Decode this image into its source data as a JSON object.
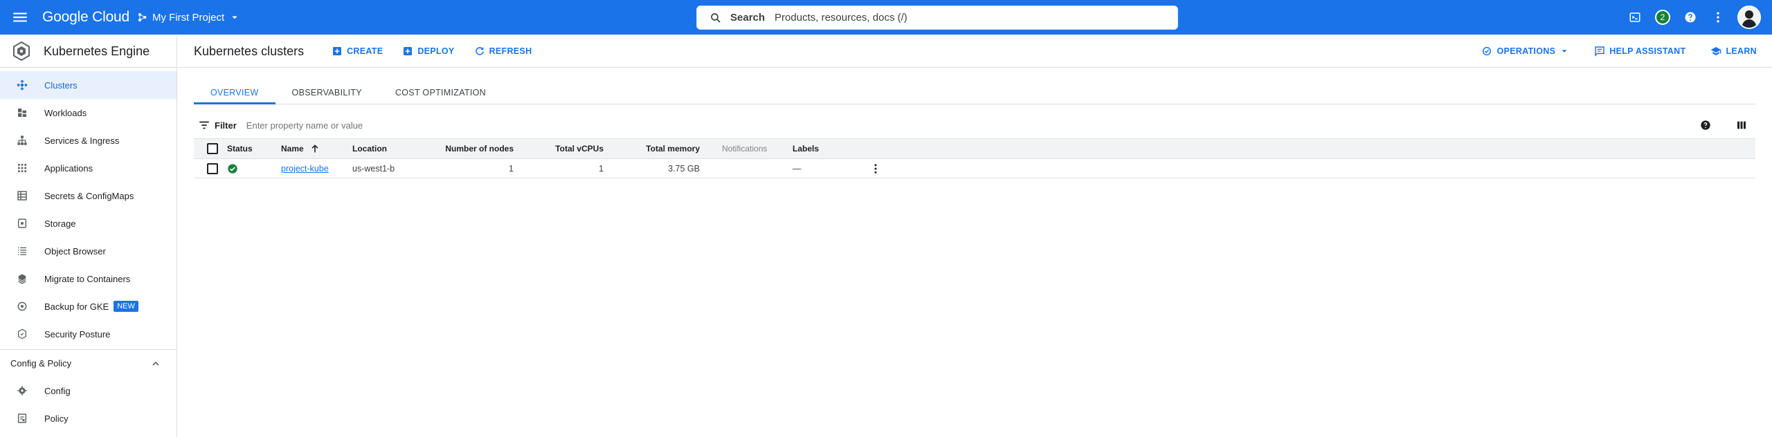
{
  "topbar": {
    "logo": "Google Cloud",
    "project": "My First Project",
    "search_label": "Search",
    "search_placeholder": "Products, resources, docs (/)",
    "notification_count": "2"
  },
  "sidebar": {
    "product": "Kubernetes Engine",
    "items": [
      {
        "label": "Clusters",
        "icon": "clusters-icon"
      },
      {
        "label": "Workloads",
        "icon": "workloads-icon"
      },
      {
        "label": "Services & Ingress",
        "icon": "services-icon"
      },
      {
        "label": "Applications",
        "icon": "applications-icon"
      },
      {
        "label": "Secrets & ConfigMaps",
        "icon": "secrets-icon"
      },
      {
        "label": "Storage",
        "icon": "storage-icon"
      },
      {
        "label": "Object Browser",
        "icon": "object-browser-icon"
      },
      {
        "label": "Migrate to Containers",
        "icon": "migrate-icon"
      },
      {
        "label": "Backup for GKE",
        "icon": "backup-icon",
        "badge": "NEW"
      },
      {
        "label": "Security Posture",
        "icon": "security-icon"
      }
    ],
    "section": {
      "label": "Config & Policy",
      "items": [
        {
          "label": "Config",
          "icon": "config-icon"
        },
        {
          "label": "Policy",
          "icon": "policy-icon"
        }
      ]
    }
  },
  "main": {
    "title": "Kubernetes clusters",
    "actions": {
      "create": "CREATE",
      "deploy": "DEPLOY",
      "refresh": "REFRESH"
    },
    "right_actions": {
      "operations": "OPERATIONS",
      "help_assistant": "HELP ASSISTANT",
      "learn": "LEARN"
    },
    "tabs": [
      "OVERVIEW",
      "OBSERVABILITY",
      "COST OPTIMIZATION"
    ],
    "filter": {
      "label": "Filter",
      "placeholder": "Enter property name or value"
    },
    "table": {
      "columns": {
        "status": "Status",
        "name": "Name",
        "location": "Location",
        "nodes": "Number of nodes",
        "vcpus": "Total vCPUs",
        "memory": "Total memory",
        "notifications": "Notifications",
        "labels": "Labels"
      },
      "rows": [
        {
          "status": "ok",
          "name": "project-kube",
          "location": "us-west1-b",
          "nodes": "1",
          "vcpus": "1",
          "memory": "3.75 GB",
          "notifications": "",
          "labels": "—"
        }
      ]
    }
  },
  "colors": {
    "accent": "#1a73e8",
    "status_ok": "#188038"
  }
}
